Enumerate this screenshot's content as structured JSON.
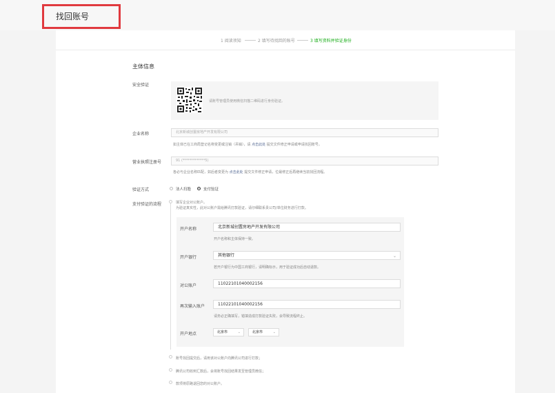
{
  "header": {
    "title": "找回账号"
  },
  "steps": [
    {
      "label": "1 阅读须知",
      "active": false
    },
    {
      "label": "2 填写待找回的账号",
      "active": false
    },
    {
      "label": "3 填写资料并验证身份",
      "active": true
    }
  ],
  "form": {
    "section_title": "主体信息",
    "security": {
      "label": "安全验证",
      "qr_text": "请账号管理员使用微信扫描二维码进行身份验证。"
    },
    "company": {
      "label": "企业名称",
      "value": "北京新城创置房地产开发有限公司",
      "hint_prefix": "如主体已在工商局登记名称变更或注销（吊销），请",
      "hint_link": "点击此处",
      "hint_suffix": "提交文件修正申请或申请找回账号。"
    },
    "license": {
      "label": "营业执照注册号",
      "value": "91 (*************5)",
      "hint_prefix": "各必与企业名称匹配，如后者变更为",
      "hint_link": "点击此处",
      "hint_suffix": "提交文件修正申请，位最修正后再继续当前找回流程。"
    },
    "verify_method": {
      "label": "验证方式",
      "options": [
        {
          "label": "法人扫脸",
          "checked": false
        },
        {
          "label": "支付验证",
          "checked": true
        }
      ]
    },
    "payment": {
      "label": "支付验证的流程",
      "step1_title": "填写企业对公账户。",
      "step1_desc": "为验证真实性，此对公账户需给腾讯打款验证，请仔细联系贵公司/单位财务进行打款。",
      "account_name": {
        "label": "开户名称",
        "value": "北京新城创置房地产开发有限公司",
        "hint": "开户名称和主体保持一致。"
      },
      "bank": {
        "label": "开户银行",
        "value": "其他银行",
        "hint": "若开户银行为中国工商银行，请明确标示，用于验证成功后自动退款。"
      },
      "account_no": {
        "label": "对公账户",
        "value": "1102210104000215​6"
      },
      "account_no_confirm": {
        "label": "再次输入账户",
        "value": "1102210104000215​6",
        "hint": "请务必正确填写，错填造成打款验证失败，会导致流程终止。"
      },
      "location": {
        "label": "开户地点",
        "province": "北京市",
        "city": "北京市"
      },
      "step2": "账号找回提交后，请用该对公账户向腾讯公司进行打款；",
      "step3": "腾讯公司收到汇款后，会将账号找回结果发至管理员微信；",
      "step4": "款项将原路退回您的对公账户。"
    }
  }
}
